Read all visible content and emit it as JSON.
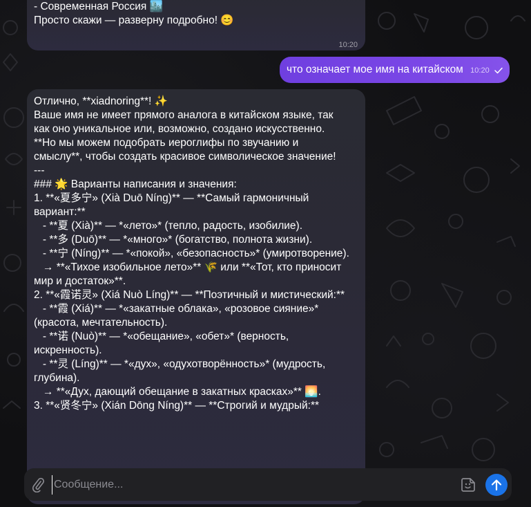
{
  "previous_message": {
    "lines": [
      "- Современная Россия 🏙️",
      "",
      "Просто скажи — разверну подробно! 😊"
    ],
    "time": "10:20"
  },
  "outgoing_message": {
    "text": "что означает мое имя на китайском",
    "time": "10:20"
  },
  "reply": {
    "lines": [
      "Отлично, **xiadnoring**! ✨",
      "Ваше имя не имеет прямого аналога в китайском языке, так",
      "как оно уникальное или, возможно, создано искусственно.",
      "**Но мы можем подобрать иероглифы по звучанию и",
      "смыслу**, чтобы создать красивое символическое значение!",
      "",
      "---",
      "",
      "### 🌟 Варианты написания и значения:",
      "1. **«夏多宁» (Xià Duō Níng)** — **Самый гармоничный",
      "вариант:**",
      "   - **夏 (Xià)** — *«лето»* (тепло, радость, изобилие).",
      "   - **多 (Duō)** — *«много»* (богатство, полнота жизни).",
      "   - **宁 (Níng)** — *«покой», «безопасность»* (умиротворение).",
      "   → **«Тихое изобильное лето»** 🌾 или **«Тот, кто приносит",
      "мир и достаток»**.",
      "",
      "2. **«霞诺灵» (Xiá Nuò Líng)** — **Поэтичный и мистический:**",
      "   - **霞 (Xiá)** — *«закатные облака», «розовое сияние»*",
      "(красота, мечтательность).",
      "   - **诺 (Nuò)** — *«обещание», «обет»* (верность,",
      "искренность).",
      "   - **灵 (Líng)** — *«дух», «одухотворённость»* (мудрость,",
      "глубина).",
      "   → **«Дух, дающий обещание в закатных красках»** 🌅.",
      "",
      "3. **«贤冬宁» (Xián Dōng Níng)** — **Строгий и мудрый:**"
    ]
  },
  "composer": {
    "placeholder": "Сообщение..."
  },
  "colors": {
    "outgoing_bubble": "#7a46e6",
    "incoming_bubble": "#2b2a36",
    "send_button": "#1a73e8"
  },
  "icons": {
    "attach": "paperclip-icon",
    "sticker": "sticker-icon",
    "send": "arrow-up-icon",
    "read": "check-icon"
  }
}
